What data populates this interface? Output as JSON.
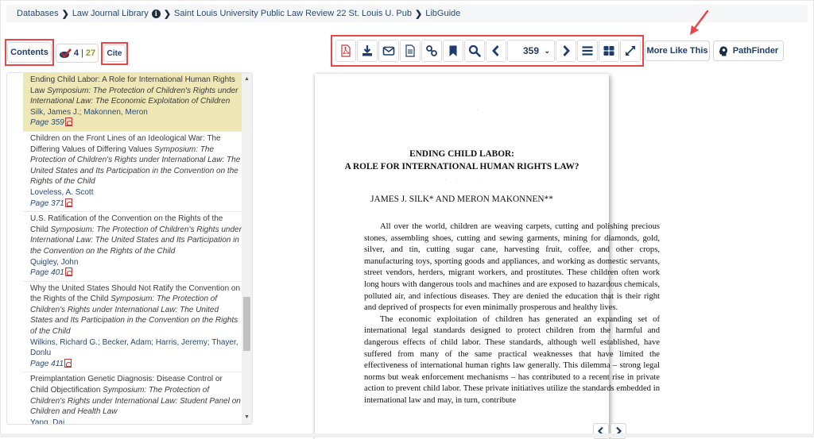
{
  "breadcrumb": {
    "items": [
      "Databases",
      "Law Journal Library",
      "Saint Louis University Public Law Review 22 St. Louis U. Pub",
      "LibGuide"
    ],
    "info_icon": "info-circle-icon",
    "separator_icon": "chevron-right-icon"
  },
  "left_tabs": {
    "contents_label": "Contents",
    "marked_count": "4",
    "marked_separator": "|",
    "total_count": "27",
    "cite_label": "Cite"
  },
  "contents_list": [
    {
      "title": "Ending Child Labor: A Role for International Human Rights Law",
      "symposium": "Symposium: The Protection of Children's Rights under International Law: The Economic Exploitation of Children",
      "authors": "Silk, James J.; Makonnen, Meron",
      "page": "Page 359",
      "active": true
    },
    {
      "title": "Children on the Front Lines of an Ideological War: The Differing Values of Differing Values",
      "symposium": "Symposium: The Protection of Children's Rights under International Law: The United States and Its Participation in the Convention on the Rights of the Child",
      "authors": "Loveless, A. Scott",
      "page": "Page 371",
      "active": false
    },
    {
      "title": "U.S. Ratification of the Convention on the Rights of the Child",
      "symposium": "Symposium: The Protection of Children's Rights under International Law: The United States and Its Participation in the Convention on the Rights of the Child",
      "authors": "Quigley, John",
      "page": "Page 401",
      "active": false
    },
    {
      "title": "Why the United States Should Not Ratify the Convention on the Rights of the Child",
      "symposium": "Symposium: The Protection of Children's Rights under International Law: The United States and Its Participation in the Convention on the Rights of the Child",
      "authors": "Wilkins, Richard G.; Becker, Adam; Harris, Jeremy; Thayer, Donlu",
      "page": "Page 411",
      "active": false
    },
    {
      "title": "Preimplantation Genetic Diagnosis: Disease Control or Child Objectification",
      "symposium": "Symposium: The Protection of Children's Rights under International Law: Student Panel on Children and Health Law",
      "authors": "Yang, Dai",
      "page": "",
      "active": false
    }
  ],
  "toolbar": {
    "buttons": [
      {
        "name": "pdf-button",
        "icon": "pdf-icon"
      },
      {
        "name": "download-button",
        "icon": "download-icon"
      },
      {
        "name": "email-button",
        "icon": "envelope-icon"
      },
      {
        "name": "text-view-button",
        "icon": "document-icon"
      },
      {
        "name": "link-button",
        "icon": "link-icon"
      },
      {
        "name": "bookmark-button",
        "icon": "bookmark-icon"
      },
      {
        "name": "search-button",
        "icon": "search-icon"
      },
      {
        "name": "previous-page-button",
        "icon": "chevron-left-icon"
      }
    ],
    "page_value": "359",
    "after_buttons": [
      {
        "name": "next-page-button",
        "icon": "chevron-right-icon"
      },
      {
        "name": "list-view-button",
        "icon": "list-icon"
      },
      {
        "name": "grid-view-button",
        "icon": "grid-icon"
      },
      {
        "name": "fullscreen-button",
        "icon": "expand-icon"
      }
    ]
  },
  "actions": {
    "more_like_this": "More Like This",
    "pathfinder": "PathFinder"
  },
  "document": {
    "title_line1": "ENDING CHILD LABOR:",
    "title_line2": "A ROLE FOR INTERNATIONAL HUMAN RIGHTS LAW?",
    "authors": "JAMES J. SILK* AND MERON MAKONNEN**",
    "paragraph1": "All over the world, children are weaving carpets, cutting and polishing precious stones, assembling shoes, cutting and sewing garments, mining for diamonds, gold, silver, and tin, cutting sugar cane, harvesting fruit, coffee, and other crops, manufacturing toys, sporting goods and appliances, and working as domestic servants, street vendors, herders, migrant workers, and prostitutes. These children often work long hours with dangerous tools and machines and are exposed to hazardous chemicals, polluted air, and infectious diseases. They are denied the education that is their right and deprived of prospects for even minimally prosperous and healthy lives.",
    "paragraph2": "The economic exploitation of children has generated an expanding set of international legal standards designed to protect children from the harmful and dangerous effects of child labor.  These standards, although well established, have suffered from many of the same practical weaknesses that have limited the effectiveness of international human rights law generally.  This dilemma – strong legal norms but weak enforcement mechanisms – has contributed to a recent rise in private action to prevent child labor.  These private initiatives utilize the standards embedded in international law and may, in turn, contribute"
  },
  "colors": {
    "highlight_outline": "#e8474a",
    "active_item_bg": "#efe8b6",
    "navy": "#1f3c6e",
    "pdf_red": "#c23a3a",
    "total_count": "#9a9a1a",
    "check_icon": "#c0282d"
  }
}
